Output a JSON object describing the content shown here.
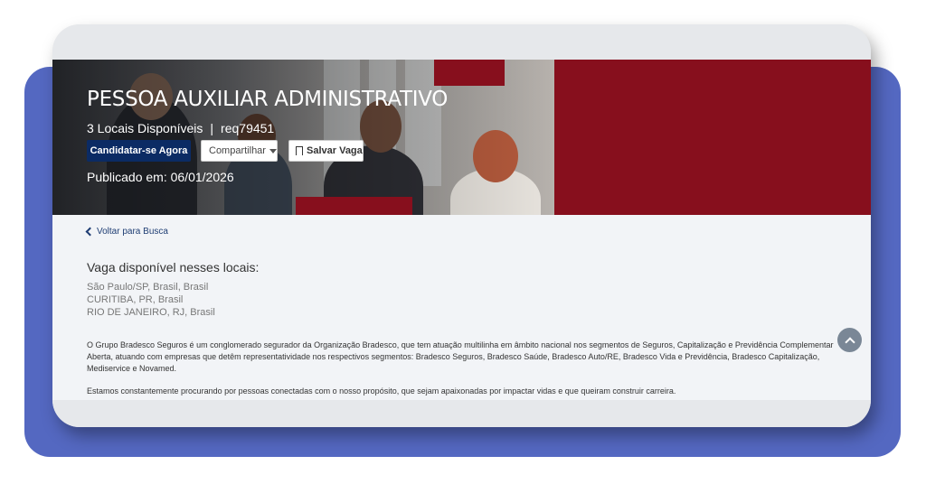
{
  "job": {
    "title": "PESSOA AUXILIAR ADMINISTRATIVO",
    "locations_available": "3 Locais Disponíveis",
    "separator": "|",
    "req_id": "req79451",
    "posted": "Publicado em: 06/01/2026"
  },
  "buttons": {
    "apply_label": "Candidatar-se Agora",
    "share_label": "Compartilhar",
    "save_label": "Salvar Vaga"
  },
  "nav": {
    "back_label": "Voltar para Busca"
  },
  "locations": {
    "heading": "Vaga disponível nesses locais:",
    "items": [
      "São Paulo/SP, Brasil, Brasil",
      "CURITIBA, PR, Brasil",
      "RIO DE JANEIRO, RJ, Brasil"
    ]
  },
  "description": {
    "paragraph1": "O Grupo Bradesco Seguros é um conglomerado segurador da Organização Bradesco, que tem atuação multilinha em âmbito nacional nos segmentos de Seguros, Capitalização e Previdência Complementar Aberta, atuando com empresas que detêm representatividade nos respectivos segmentos: Bradesco Seguros, Bradesco Saúde, Bradesco Auto/RE, Bradesco Vida e Previdência, Bradesco Capitalização, Mediservice e Novamed.",
    "paragraph2": "Estamos constantemente procurando por pessoas conectadas com o nosso propósito, que sejam apaixonadas por impactar vidas e que queiram construir carreira."
  },
  "icons": [
    "caret-down-icon",
    "bookmark-icon",
    "chevron-left-icon",
    "chevron-up-icon"
  ],
  "colors": {
    "brand_red": "#870f1d",
    "brand_navy": "#0b2b64",
    "frame_blue": "#5468c1"
  }
}
